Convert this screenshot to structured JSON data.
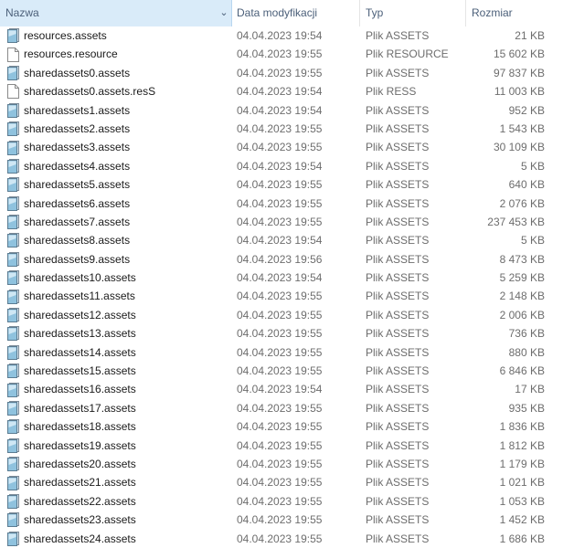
{
  "columns": {
    "name": "Nazwa",
    "date": "Data modyfikacji",
    "type": "Typ",
    "size": "Rozmiar"
  },
  "icons": {
    "sort": "sort-ascending-icon",
    "dropdown": "chevron-down-icon",
    "assets_file": "assets-file-icon",
    "blank_file": "blank-file-icon"
  },
  "files": [
    {
      "name": "resources.assets",
      "date": "04.04.2023 19:54",
      "type": "Plik ASSETS",
      "size": "21 KB",
      "icon": "assets-file-icon"
    },
    {
      "name": "resources.resource",
      "date": "04.04.2023 19:55",
      "type": "Plik RESOURCE",
      "size": "15 602 KB",
      "icon": "blank-file-icon"
    },
    {
      "name": "sharedassets0.assets",
      "date": "04.04.2023 19:55",
      "type": "Plik ASSETS",
      "size": "97 837 KB",
      "icon": "assets-file-icon"
    },
    {
      "name": "sharedassets0.assets.resS",
      "date": "04.04.2023 19:54",
      "type": "Plik RESS",
      "size": "11 003 KB",
      "icon": "blank-file-icon"
    },
    {
      "name": "sharedassets1.assets",
      "date": "04.04.2023 19:54",
      "type": "Plik ASSETS",
      "size": "952 KB",
      "icon": "assets-file-icon"
    },
    {
      "name": "sharedassets2.assets",
      "date": "04.04.2023 19:55",
      "type": "Plik ASSETS",
      "size": "1 543 KB",
      "icon": "assets-file-icon"
    },
    {
      "name": "sharedassets3.assets",
      "date": "04.04.2023 19:55",
      "type": "Plik ASSETS",
      "size": "30 109 KB",
      "icon": "assets-file-icon"
    },
    {
      "name": "sharedassets4.assets",
      "date": "04.04.2023 19:54",
      "type": "Plik ASSETS",
      "size": "5 KB",
      "icon": "assets-file-icon"
    },
    {
      "name": "sharedassets5.assets",
      "date": "04.04.2023 19:55",
      "type": "Plik ASSETS",
      "size": "640 KB",
      "icon": "assets-file-icon"
    },
    {
      "name": "sharedassets6.assets",
      "date": "04.04.2023 19:55",
      "type": "Plik ASSETS",
      "size": "2 076 KB",
      "icon": "assets-file-icon"
    },
    {
      "name": "sharedassets7.assets",
      "date": "04.04.2023 19:55",
      "type": "Plik ASSETS",
      "size": "237 453 KB",
      "icon": "assets-file-icon"
    },
    {
      "name": "sharedassets8.assets",
      "date": "04.04.2023 19:54",
      "type": "Plik ASSETS",
      "size": "5 KB",
      "icon": "assets-file-icon"
    },
    {
      "name": "sharedassets9.assets",
      "date": "04.04.2023 19:56",
      "type": "Plik ASSETS",
      "size": "8 473 KB",
      "icon": "assets-file-icon"
    },
    {
      "name": "sharedassets10.assets",
      "date": "04.04.2023 19:54",
      "type": "Plik ASSETS",
      "size": "5 259 KB",
      "icon": "assets-file-icon"
    },
    {
      "name": "sharedassets11.assets",
      "date": "04.04.2023 19:55",
      "type": "Plik ASSETS",
      "size": "2 148 KB",
      "icon": "assets-file-icon"
    },
    {
      "name": "sharedassets12.assets",
      "date": "04.04.2023 19:55",
      "type": "Plik ASSETS",
      "size": "2 006 KB",
      "icon": "assets-file-icon"
    },
    {
      "name": "sharedassets13.assets",
      "date": "04.04.2023 19:55",
      "type": "Plik ASSETS",
      "size": "736 KB",
      "icon": "assets-file-icon"
    },
    {
      "name": "sharedassets14.assets",
      "date": "04.04.2023 19:55",
      "type": "Plik ASSETS",
      "size": "880 KB",
      "icon": "assets-file-icon"
    },
    {
      "name": "sharedassets15.assets",
      "date": "04.04.2023 19:55",
      "type": "Plik ASSETS",
      "size": "6 846 KB",
      "icon": "assets-file-icon"
    },
    {
      "name": "sharedassets16.assets",
      "date": "04.04.2023 19:54",
      "type": "Plik ASSETS",
      "size": "17 KB",
      "icon": "assets-file-icon"
    },
    {
      "name": "sharedassets17.assets",
      "date": "04.04.2023 19:55",
      "type": "Plik ASSETS",
      "size": "935 KB",
      "icon": "assets-file-icon"
    },
    {
      "name": "sharedassets18.assets",
      "date": "04.04.2023 19:55",
      "type": "Plik ASSETS",
      "size": "1 836 KB",
      "icon": "assets-file-icon"
    },
    {
      "name": "sharedassets19.assets",
      "date": "04.04.2023 19:55",
      "type": "Plik ASSETS",
      "size": "1 812 KB",
      "icon": "assets-file-icon"
    },
    {
      "name": "sharedassets20.assets",
      "date": "04.04.2023 19:55",
      "type": "Plik ASSETS",
      "size": "1 179 KB",
      "icon": "assets-file-icon"
    },
    {
      "name": "sharedassets21.assets",
      "date": "04.04.2023 19:55",
      "type": "Plik ASSETS",
      "size": "1 021 KB",
      "icon": "assets-file-icon"
    },
    {
      "name": "sharedassets22.assets",
      "date": "04.04.2023 19:55",
      "type": "Plik ASSETS",
      "size": "1 053 KB",
      "icon": "assets-file-icon"
    },
    {
      "name": "sharedassets23.assets",
      "date": "04.04.2023 19:55",
      "type": "Plik ASSETS",
      "size": "1 452 KB",
      "icon": "assets-file-icon"
    },
    {
      "name": "sharedassets24.assets",
      "date": "04.04.2023 19:55",
      "type": "Plik ASSETS",
      "size": "1 686 KB",
      "icon": "assets-file-icon"
    }
  ]
}
